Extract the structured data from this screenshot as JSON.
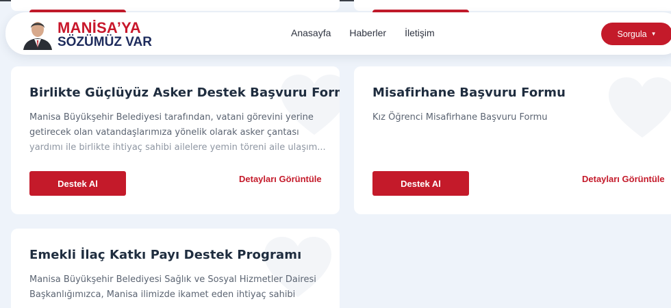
{
  "header": {
    "logo_line1": "MANİSA’YA",
    "logo_line2": "SÖZÜMÜZ VAR",
    "nav": [
      {
        "label": "Anasayfa"
      },
      {
        "label": "Haberler"
      },
      {
        "label": "İletişim"
      }
    ],
    "sorgula_label": "Sorgula",
    "caret_icon": "caret-down-icon"
  },
  "cards": [
    {
      "title": "Birlikte Güçlüyüz Asker Destek Başvuru Formu",
      "description_lines": [
        "Manisa Büyükşehir Belediyesi tarafından, vatani görevini yerine",
        "getirecek olan vatandaşlarımıza yönelik olarak asker çantası",
        "yardımı ile birlikte ihtiyaç sahibi ailelere yemin töreni aile ulaşım..."
      ],
      "button_label": "Destek Al",
      "link_label": "Detayları Görüntüle"
    },
    {
      "title": "Misafirhane Başvuru Formu",
      "description_lines": [
        "Kız Öğrenci Misafirhane Başvuru Formu"
      ],
      "button_label": "Destek Al",
      "link_label": "Detayları Görüntüle"
    },
    {
      "title": "Emekli İlaç Katkı Payı Destek Programı",
      "description_lines": [
        "Manisa Büyükşehir Belediyesi Sağlık ve Sosyal Hizmetler Dairesi",
        "Başkanlığımızca, Manisa ilimizde ikamet eden ihtiyaç sahibi"
      ]
    }
  ],
  "colors": {
    "brand_red": "#c41a2a",
    "brand_navy": "#1d2b5c",
    "page_bg": "#eef3fa"
  }
}
